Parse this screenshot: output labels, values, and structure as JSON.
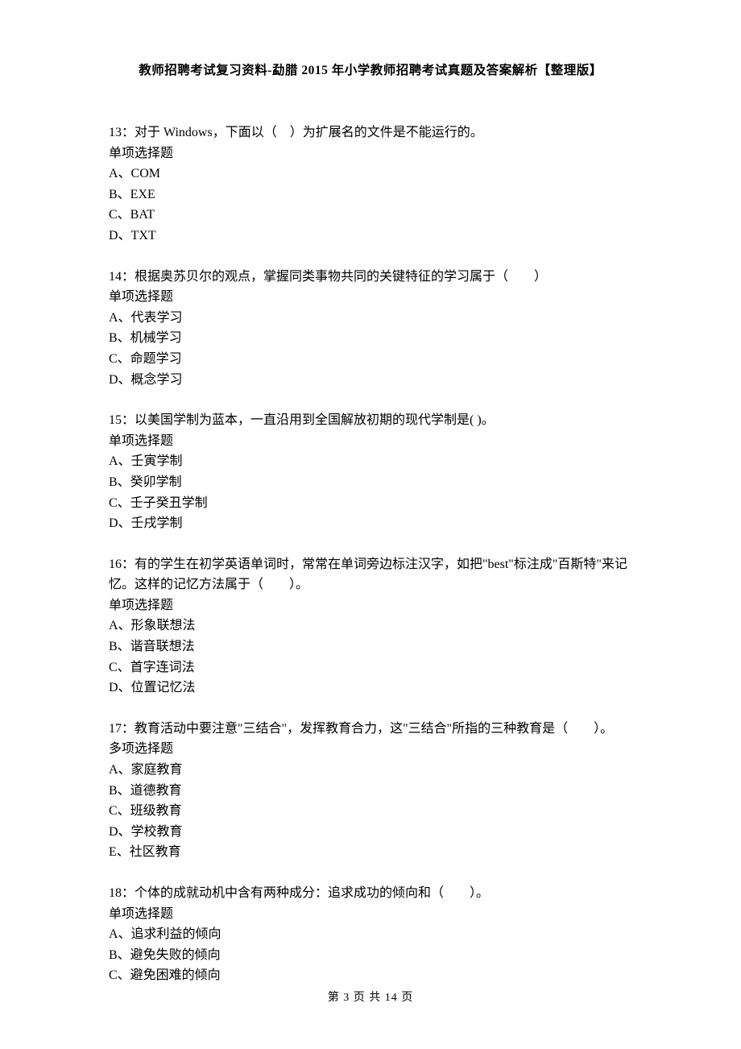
{
  "header": "教师招聘考试复习资料-勐腊 2015 年小学教师招聘考试真题及答案解析【整理版】",
  "questions": [
    {
      "text": "13：对于 Windows，下面以（　）为扩展名的文件是不能运行的。",
      "type": "单项选择题",
      "options": [
        "A、COM",
        "B、EXE",
        "C、BAT",
        "D、TXT"
      ]
    },
    {
      "text": "14：根据奥苏贝尔的观点，掌握同类事物共同的关键特征的学习属于（　　）",
      "type": "单项选择题",
      "options": [
        "A、代表学习",
        "B、机械学习",
        "C、命题学习",
        "D、概念学习"
      ]
    },
    {
      "text": "15：以美国学制为蓝本，一直沿用到全国解放初期的现代学制是( )。",
      "type": "单项选择题",
      "options": [
        "A、壬寅学制",
        "B、癸卯学制",
        "C、壬子癸丑学制",
        "D、壬戌学制"
      ]
    },
    {
      "text": "16：有的学生在初学英语单词时，常常在单词旁边标注汉字，如把\"best\"标注成\"百斯特\"来记忆。这样的记忆方法属于（　　）。",
      "type": "单项选择题",
      "options": [
        "A、形象联想法",
        "B、谐音联想法",
        "C、首字连词法",
        "D、位置记忆法"
      ]
    },
    {
      "text": "17：教育活动中要注意\"三结合\"，发挥教育合力，这\"三结合\"所指的三种教育是（　　）。",
      "type": "多项选择题",
      "options": [
        "A、家庭教育",
        "B、道德教育",
        "C、班级教育",
        "D、学校教育",
        "E、社区教育"
      ]
    },
    {
      "text": "18：个体的成就动机中含有两种成分：追求成功的倾向和（　　）。",
      "type": "单项选择题",
      "options": [
        "A、追求利益的倾向",
        "B、避免失败的倾向",
        "C、避免困难的倾向"
      ]
    }
  ],
  "footer": "第 3 页 共 14 页"
}
